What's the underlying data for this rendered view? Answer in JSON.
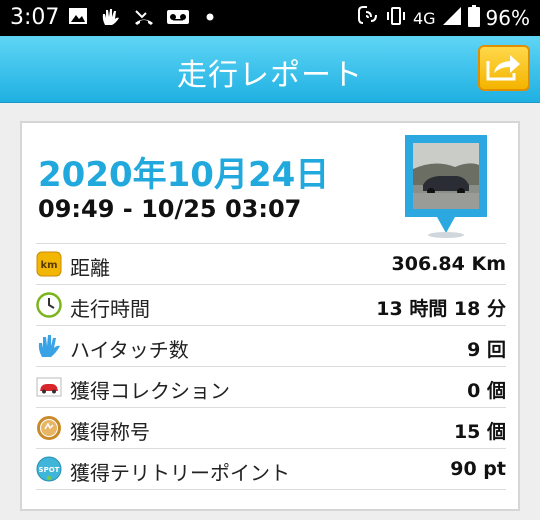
{
  "status": {
    "time": "3:07",
    "network": "4G",
    "battery": "96%"
  },
  "header": {
    "title": "走行レポート"
  },
  "report": {
    "date": "2020年10月24日",
    "time_range": "09:49 - 10/25 03:07",
    "rows": [
      {
        "label": "距離",
        "value": "306.84 Km",
        "icon": "km-icon"
      },
      {
        "label": "走行時間",
        "value": "13 時間 18 分",
        "icon": "clock-icon"
      },
      {
        "label": "ハイタッチ数",
        "value": "9 回",
        "icon": "hand-icon"
      },
      {
        "label": "獲得コレクション",
        "value": "0 個",
        "icon": "car-icon"
      },
      {
        "label": "獲得称号",
        "value": "15 個",
        "icon": "medal-icon"
      },
      {
        "label": "獲得テリトリーポイント",
        "value": "90 pt",
        "icon": "spot-icon"
      }
    ]
  },
  "icon_text": {
    "km": "km",
    "spot": "SPOT"
  },
  "colors": {
    "header": "#29b6e6",
    "accent": "#21a9de",
    "share_button": "#f7c21a"
  }
}
